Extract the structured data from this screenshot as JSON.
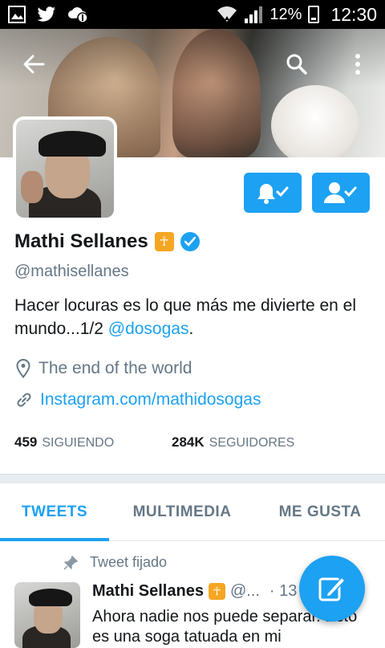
{
  "status_bar": {
    "battery": "12%",
    "time": "12:30",
    "icons": [
      "gallery-icon",
      "twitter-icon",
      "cloud-notification-icon",
      "wifi-icon",
      "signal-icon",
      "battery-icon"
    ]
  },
  "header": {
    "back_icon": "back-arrow-icon",
    "search_icon": "search-icon",
    "overflow_icon": "more-vertical-icon"
  },
  "profile": {
    "name": "Mathi Sellanes",
    "name_emoji": "☥",
    "handle": "@mathisellanes",
    "bio_text": "Hacer locuras es lo que más me divierte en el mundo...1/2 ",
    "bio_mention": "@dosogas",
    "bio_end": ".",
    "location": "The end of the world",
    "website": "Instagram.com/mathidosogas",
    "following_count": "459",
    "following_label": "SIGUIENDO",
    "followers_count": "284K",
    "followers_label": "SEGUIDORES",
    "accent_color": "#1da1f2"
  },
  "tabs": [
    {
      "label": "TWEETS",
      "active": true
    },
    {
      "label": "MULTIMEDIA",
      "active": false
    },
    {
      "label": "ME GUSTA",
      "active": false
    }
  ],
  "tweet": {
    "pinned_label": "Tweet fijado",
    "name": "Mathi Sellanes",
    "handle": "@...",
    "date": "· 13 f",
    "text": "Ahora nadie nos puede separar. Esto es una soga tatuada en mi"
  }
}
